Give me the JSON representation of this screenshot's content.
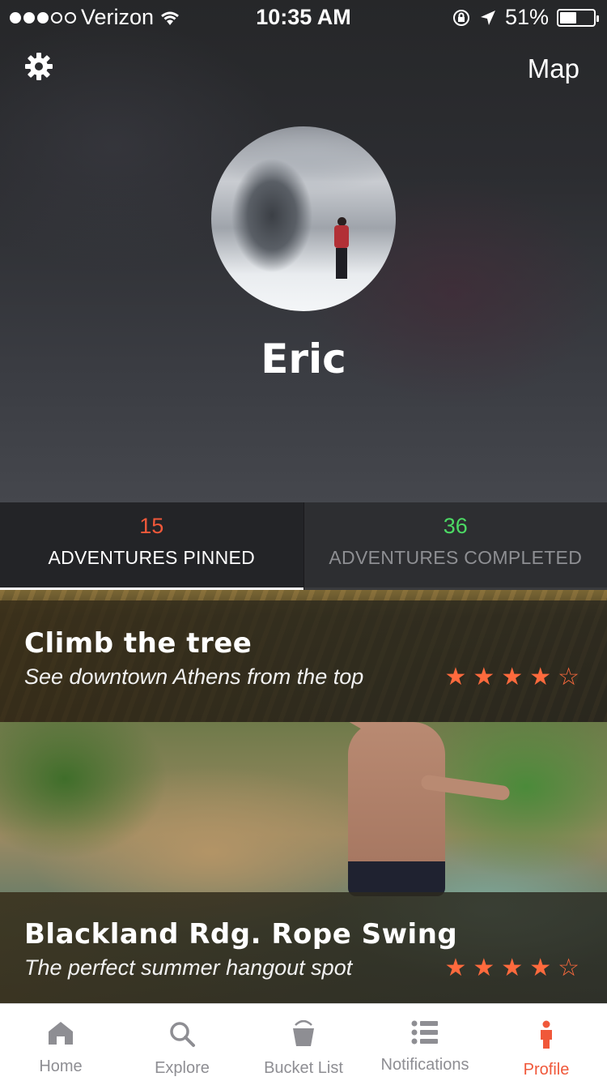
{
  "status": {
    "carrier": "Verizon",
    "time": "10:35 AM",
    "battery": "51%",
    "battery_level": 0.51,
    "signal_bars": 3
  },
  "header": {
    "map_label": "Map",
    "user_name": "Eric"
  },
  "stats": {
    "pinned_count": "15",
    "pinned_label": "ADVENTURES PINNED",
    "completed_count": "36",
    "completed_label": "ADVENTURES COMPLETED",
    "pinned_color": "#f0583a",
    "completed_color": "#4cd964"
  },
  "adventures": [
    {
      "title": "Climb the tree",
      "subtitle": "See downtown Athens from the top",
      "rating": 4
    },
    {
      "title": "Blackland Rdg. Rope Swing",
      "subtitle": "The perfect summer hangout spot",
      "rating": 4
    }
  ],
  "tabbar": {
    "items": [
      {
        "label": "Home",
        "icon": "home-icon"
      },
      {
        "label": "Explore",
        "icon": "search-icon"
      },
      {
        "label": "Bucket List",
        "icon": "bucket-icon"
      },
      {
        "label": "Notifications",
        "icon": "list-icon"
      },
      {
        "label": "Profile",
        "icon": "person-icon"
      }
    ],
    "active_color": "#f0583a",
    "inactive_color": "#8e8e93"
  }
}
